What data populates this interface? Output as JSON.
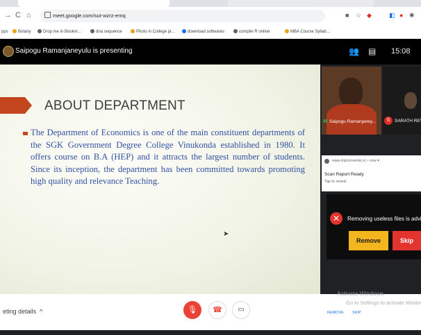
{
  "browser": {
    "url": "meet.google.com/sut-wzrz-emq",
    "nav": {
      "back": "→",
      "forward": "C",
      "home": "⌂"
    },
    "bookmarks": [
      {
        "label": "pps",
        "color": "#1a73e8"
      },
      {
        "label": "Botany",
        "color": "#e8a317"
      },
      {
        "label": "Drop me in Bookm...",
        "color": "#5f6368"
      },
      {
        "label": "dna sequence",
        "color": "#5f6368"
      },
      {
        "label": "Photo in College pi...",
        "color": "#e8a317"
      },
      {
        "label": "download softwares",
        "color": "#1a73e8"
      },
      {
        "label": "compile R online",
        "color": "#5f6368"
      },
      {
        "label": "MBA Course Syllab...",
        "color": "#e8a317"
      }
    ]
  },
  "meet": {
    "presenting": "Saipogu Ramanjaneyulu is presenting",
    "clock": "15:08",
    "slide": {
      "title": "ABOUT DEPARTMENT",
      "body": "The Department of Economics is one of the main constituent departments of the SGK Government Degree College Vinukonda established in 1980. It offers course on B.A (HEP) and it attracts the largest number  of students. Since its inception, the department has been committed towards promoting high quality and relevance Teaching."
    },
    "participants": [
      {
        "name": "Saipogu Ramanjaney..."
      },
      {
        "name": "SARATH REV",
        "initial": "S"
      }
    ],
    "meeting_details": "eting details",
    "chevron": "^"
  },
  "notification": {
    "source": "www.clipconverter.cc • now ▾",
    "title": "Scan Report Ready",
    "subtitle": "Tap to reveal"
  },
  "popup": {
    "message": "Removing useless files is advis",
    "remove": "Remove",
    "skip": "Skip"
  },
  "footer_links": {
    "remove": "REMOVE",
    "skip": "SKIP"
  },
  "watermark": {
    "line1": "Activate Windows",
    "line2": "Go to Settings to activate Windows"
  },
  "colors": {
    "accent": "#c3461f",
    "body_text": "#3050a0",
    "remove_btn": "#f3b61f",
    "skip_btn": "#e3342f"
  }
}
